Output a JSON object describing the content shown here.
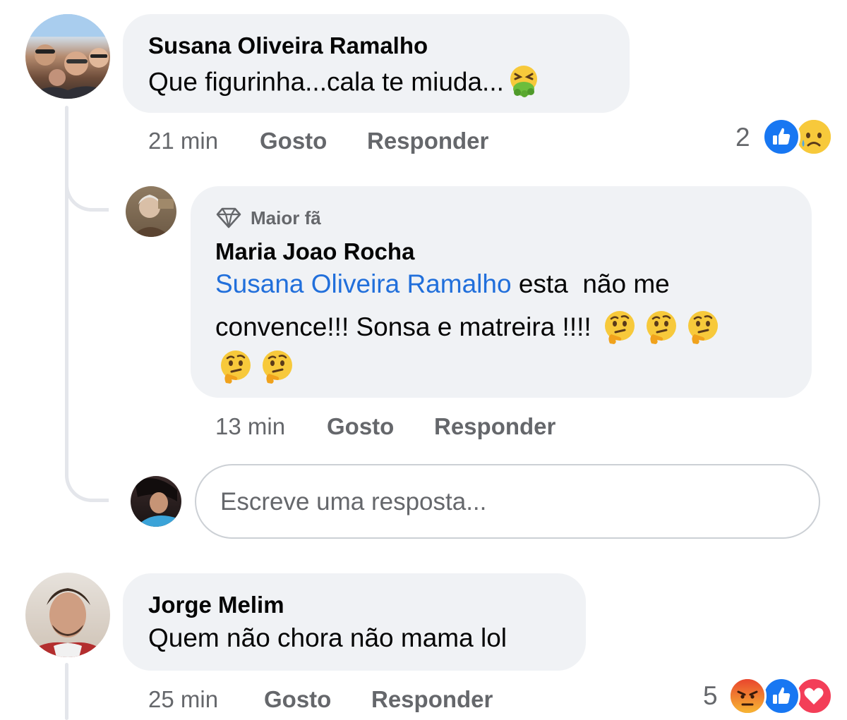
{
  "comments": [
    {
      "author": "Susana Oliveira Ramalho",
      "text": "Que figurinha...cala te miuda...",
      "emoji": "nauseated-face-emoji",
      "time": "21 min",
      "like_label": "Gosto",
      "reply_label": "Responder",
      "reaction_count": "2",
      "reactions": [
        "like-reaction-icon",
        "sad-reaction-icon"
      ],
      "reply": {
        "badge": "Maior fã",
        "author": "Maria Joao Rocha",
        "mention": "Susana Oliveira Ramalho",
        "line1_rest": " esta  não me",
        "line2": "convence!!! Sonsa e matreira !!!!",
        "emoji": "thinking-face-emoji",
        "emoji_count": 5,
        "time": "13 min",
        "like_label": "Gosto",
        "reply_label": "Responder"
      },
      "reply_input_placeholder": "Escreve uma resposta..."
    },
    {
      "author": "Jorge Melim",
      "text": "Quem não chora não mama lol",
      "time": "25 min",
      "like_label": "Gosto",
      "reply_label": "Responder",
      "reaction_count": "5",
      "reactions": [
        "angry-reaction-icon",
        "like-reaction-icon",
        "love-reaction-icon"
      ]
    }
  ],
  "colors": {
    "bubble": "#f0f2f5",
    "mention": "#216fdb",
    "meta_text": "#65676b",
    "like_blue": "#1877f2",
    "love_red": "#f33e58"
  }
}
